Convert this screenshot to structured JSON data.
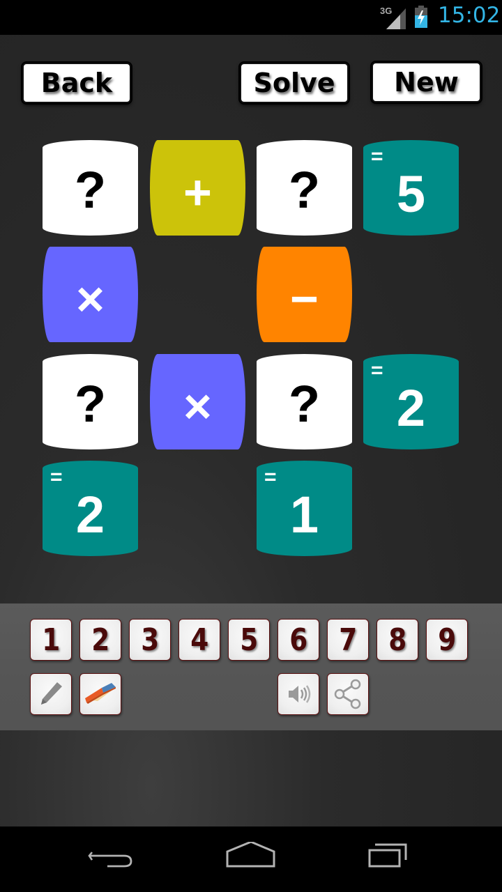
{
  "status_bar": {
    "network_type": "3G",
    "time": "15:02",
    "battery_state": "charging"
  },
  "toolbar": {
    "back_label": "Back",
    "solve_label": "Solve",
    "new_label": "New"
  },
  "puzzle": {
    "rows": [
      [
        {
          "type": "unknown",
          "symbol": "?"
        },
        {
          "type": "operator",
          "symbol": "+",
          "color": "#ccc30a"
        },
        {
          "type": "unknown",
          "symbol": "?"
        },
        {
          "type": "result",
          "equals": "=",
          "symbol": "5"
        }
      ],
      [
        {
          "type": "operator",
          "symbol": "×",
          "color": "#6666ff"
        },
        {
          "type": "empty"
        },
        {
          "type": "operator",
          "symbol": "−",
          "color": "#ff8400"
        },
        {
          "type": "empty"
        }
      ],
      [
        {
          "type": "unknown",
          "symbol": "?"
        },
        {
          "type": "operator",
          "symbol": "×",
          "color": "#6666ff"
        },
        {
          "type": "unknown",
          "symbol": "?"
        },
        {
          "type": "result",
          "equals": "=",
          "symbol": "2"
        }
      ],
      [
        {
          "type": "result",
          "equals": "=",
          "symbol": "2"
        },
        {
          "type": "empty"
        },
        {
          "type": "result",
          "equals": "=",
          "symbol": "1"
        },
        {
          "type": "empty"
        }
      ]
    ],
    "colors": {
      "unknown_bg": "#ffffff",
      "result_bg": "#008b87"
    }
  },
  "keypad": {
    "digits": [
      "1",
      "2",
      "3",
      "4",
      "5",
      "6",
      "7",
      "8",
      "9"
    ],
    "tools": [
      {
        "name": "pencil",
        "icon": "pencil-icon"
      },
      {
        "name": "eraser",
        "icon": "eraser-icon"
      },
      {
        "name": "sound",
        "icon": "speaker-icon"
      },
      {
        "name": "share",
        "icon": "share-icon"
      }
    ]
  },
  "nav_bar": {
    "buttons": [
      "back",
      "home",
      "recents"
    ]
  }
}
